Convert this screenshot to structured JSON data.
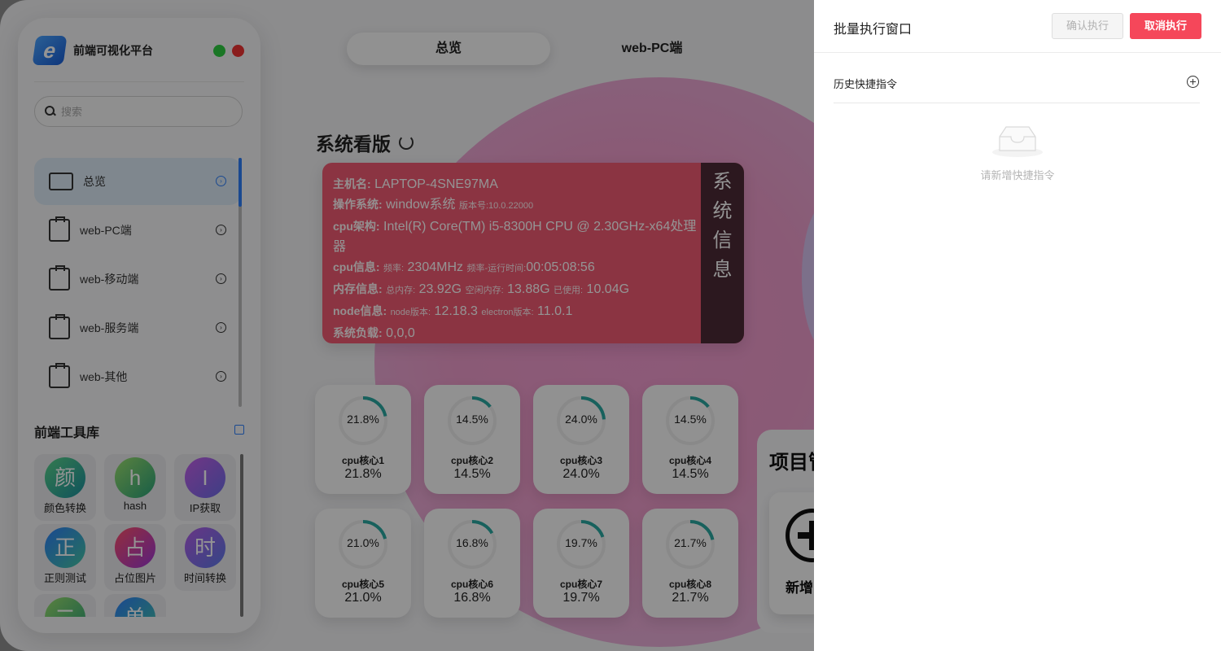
{
  "sidebar": {
    "brand": "前端可视化平台",
    "search_placeholder": "搜索",
    "nav": [
      {
        "label": "总览",
        "active": true
      },
      {
        "label": "web-PC端"
      },
      {
        "label": "web-移动端"
      },
      {
        "label": "web-服务端"
      },
      {
        "label": "web-其他"
      }
    ],
    "tools_title": "前端工具库",
    "tools": [
      {
        "glyph": "颜",
        "label": "颜色转换"
      },
      {
        "glyph": "h",
        "label": "hash"
      },
      {
        "glyph": "I",
        "label": "IP获取"
      },
      {
        "glyph": "正",
        "label": "正则测试"
      },
      {
        "glyph": "占",
        "label": "占位图片"
      },
      {
        "glyph": "时",
        "label": "时间转换"
      },
      {
        "glyph": "二",
        "label": ""
      },
      {
        "glyph": "单",
        "label": ""
      }
    ]
  },
  "tabs": [
    "总览",
    "web-PC端"
  ],
  "dashboard": {
    "title": "系统看版",
    "sysinfo": {
      "host_key": "主机名:",
      "host": "LAPTOP-4SNE97MA",
      "os_key": "操作系统:",
      "os": "window系统",
      "os_ver_key": "版本号:",
      "os_ver": "10.0.22000",
      "cpu_key": "cpu架构:",
      "cpu": "Intel(R) Core(TM) i5-8300H CPU @ 2.30GHz-x64处理器",
      "cpuinfo_key": "cpu信息:",
      "freq_key": "频率:",
      "freq": "2304MHz",
      "uptime_key": "频率-运行时间:",
      "uptime": "00:05:08:56",
      "mem_key": "内存信息:",
      "mem_total_key": "总内存:",
      "mem_total": "23.92G",
      "mem_free_key": "空闲内存:",
      "mem_free": "13.88G",
      "mem_used_key": "已使用:",
      "mem_used": "10.04G",
      "node_key": "node信息:",
      "node_ver_key": "node版本:",
      "node_ver": "12.18.3",
      "electron_ver_key": "electron版本:",
      "electron_ver": "11.0.1",
      "load_key": "系统负载:",
      "load": "0,0,0",
      "side_label": [
        "系",
        "统",
        "信",
        "息"
      ]
    },
    "cores": [
      {
        "name": "cpu核心1",
        "pct": "21.8%",
        "value": 21.8
      },
      {
        "name": "cpu核心2",
        "pct": "14.5%",
        "value": 14.5
      },
      {
        "name": "cpu核心3",
        "pct": "24.0%",
        "value": 24.0
      },
      {
        "name": "cpu核心4",
        "pct": "14.5%",
        "value": 14.5
      },
      {
        "name": "cpu核心5",
        "pct": "21.0%",
        "value": 21.0
      },
      {
        "name": "cpu核心6",
        "pct": "16.8%",
        "value": 16.8
      },
      {
        "name": "cpu核心7",
        "pct": "19.7%",
        "value": 19.7
      },
      {
        "name": "cpu核心8",
        "pct": "21.7%",
        "value": 21.7
      }
    ],
    "project_title": "项目管",
    "project_add": "新增"
  },
  "drawer": {
    "title": "批量执行窗口",
    "confirm_label": "确认执行",
    "cancel_label": "取消执行",
    "section_title": "历史快捷指令",
    "empty_text": "请新增快捷指令"
  },
  "colors": {
    "accent": "#2d7ff9",
    "danger": "#f5475a",
    "sysinfo_bg": "#f05a72"
  }
}
